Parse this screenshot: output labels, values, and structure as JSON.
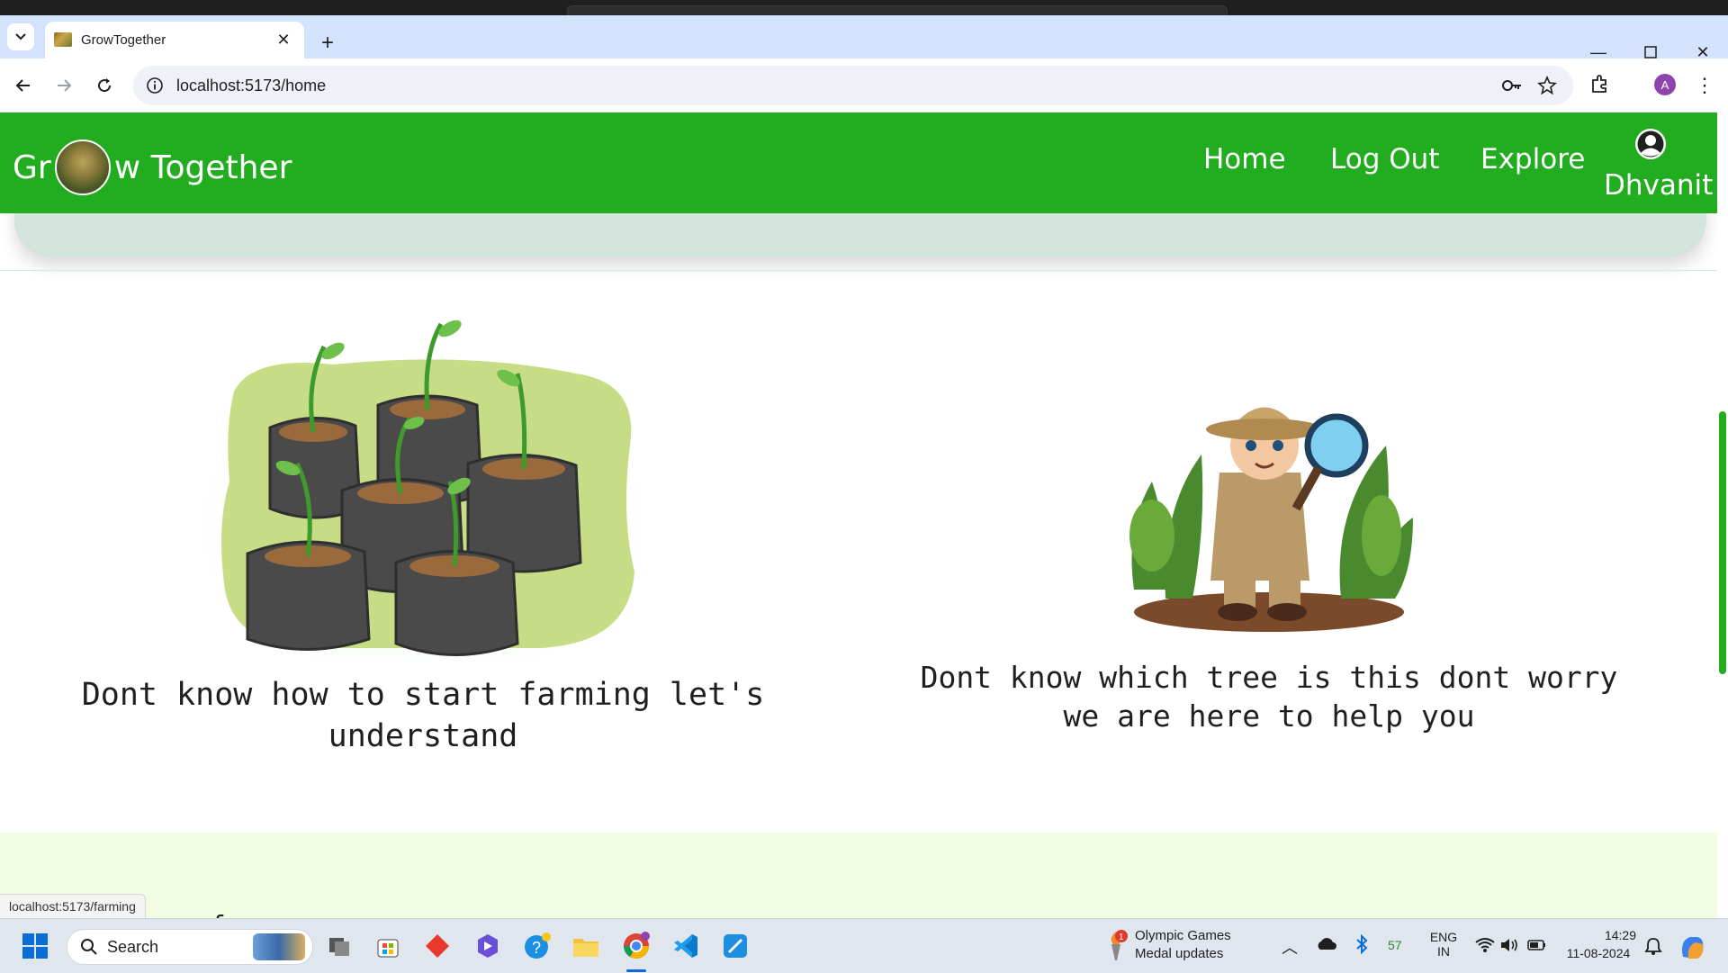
{
  "browser": {
    "tab_title": "GrowTogether",
    "url": "localhost:5173/home",
    "profile_initial": "A",
    "status_url": "localhost:5173/farming"
  },
  "site": {
    "brand_prefix": "Gr",
    "brand_suffix": "w Together",
    "nav": {
      "home": "Home",
      "logout": "Log Out",
      "explore": "Explore"
    },
    "username": "Dhvanit",
    "accent": "#22ac1f"
  },
  "features": [
    {
      "caption": "Dont know how to start farming let's understand"
    },
    {
      "caption": "Dont know which tree is this dont worry we are here to help you"
    }
  ],
  "next_section_peek": "r  f",
  "taskbar": {
    "search_label": "Search",
    "news_title": "Olympic Games",
    "news_subtitle": "Medal updates",
    "news_badge": "1",
    "battery": "57",
    "lang_top": "ENG",
    "lang_bottom": "IN",
    "time": "14:29",
    "date": "11-08-2024"
  }
}
